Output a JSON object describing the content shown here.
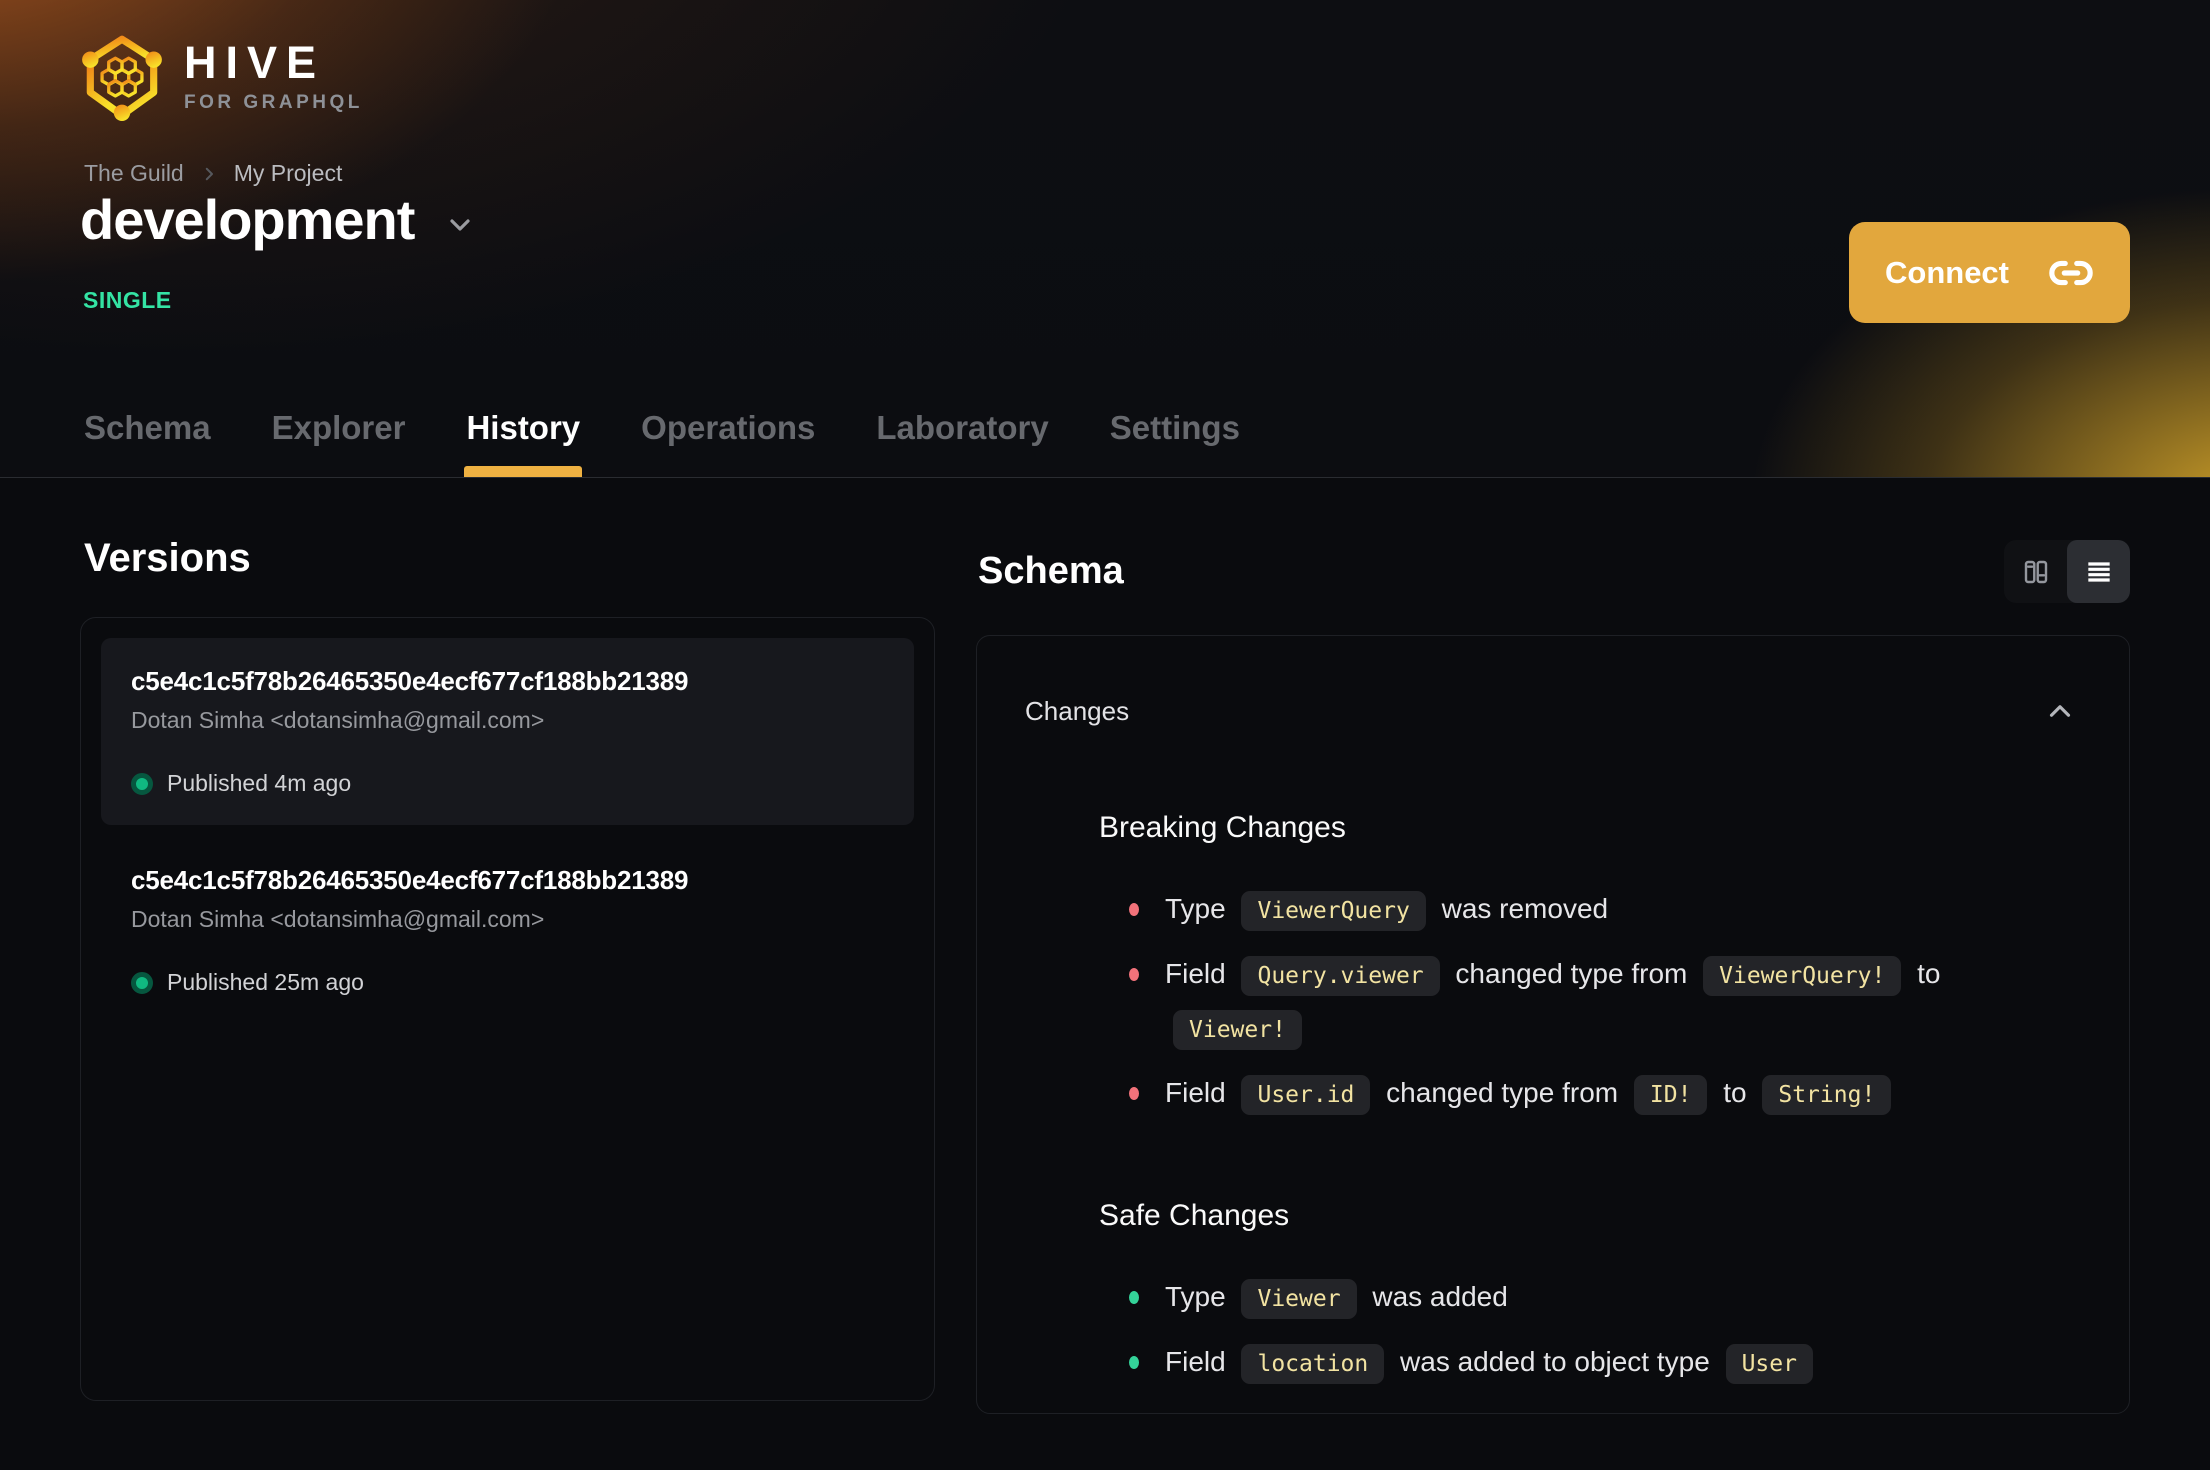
{
  "brand": {
    "name": "HIVE",
    "tagline": "FOR GRAPHQL"
  },
  "breadcrumb": {
    "org": "The Guild",
    "project": "My Project"
  },
  "target": {
    "name": "development",
    "badge": "SINGLE"
  },
  "connect": {
    "label": "Connect"
  },
  "tabs": [
    {
      "label": "Schema",
      "active": false
    },
    {
      "label": "Explorer",
      "active": false
    },
    {
      "label": "History",
      "active": true
    },
    {
      "label": "Operations",
      "active": false
    },
    {
      "label": "Laboratory",
      "active": false
    },
    {
      "label": "Settings",
      "active": false
    }
  ],
  "versions": {
    "title": "Versions",
    "items": [
      {
        "hash": "c5e4c1c5f78b26465350e4ecf677cf188bb21389",
        "author": "Dotan Simha <dotansimha@gmail.com>",
        "status": "Published 4m ago",
        "selected": true
      },
      {
        "hash": "c5e4c1c5f78b26465350e4ecf677cf188bb21389",
        "author": "Dotan Simha <dotansimha@gmail.com>",
        "status": "Published 25m ago",
        "selected": false
      }
    ]
  },
  "schema": {
    "title": "Schema",
    "panel": {
      "header": "Changes",
      "sections": [
        {
          "title": "Breaking Changes",
          "severity": "breaking",
          "items": [
            [
              {
                "t": "text",
                "v": "Type "
              },
              {
                "t": "code",
                "v": "ViewerQuery"
              },
              {
                "t": "text",
                "v": " was removed"
              }
            ],
            [
              {
                "t": "text",
                "v": "Field "
              },
              {
                "t": "code",
                "v": "Query.viewer"
              },
              {
                "t": "text",
                "v": " changed type from "
              },
              {
                "t": "code",
                "v": "ViewerQuery!"
              },
              {
                "t": "text",
                "v": " to "
              },
              {
                "t": "code",
                "v": "Viewer!"
              }
            ],
            [
              {
                "t": "text",
                "v": "Field "
              },
              {
                "t": "code",
                "v": "User.id"
              },
              {
                "t": "text",
                "v": " changed type from "
              },
              {
                "t": "code",
                "v": "ID!"
              },
              {
                "t": "text",
                "v": " to "
              },
              {
                "t": "code",
                "v": "String!"
              }
            ]
          ]
        },
        {
          "title": "Safe Changes",
          "severity": "safe",
          "items": [
            [
              {
                "t": "text",
                "v": "Type "
              },
              {
                "t": "code",
                "v": "Viewer"
              },
              {
                "t": "text",
                "v": " was added"
              }
            ],
            [
              {
                "t": "text",
                "v": "Field "
              },
              {
                "t": "code",
                "v": "location"
              },
              {
                "t": "text",
                "v": " was added to object type "
              },
              {
                "t": "code",
                "v": "User"
              }
            ]
          ]
        }
      ]
    }
  },
  "colors": {
    "accent": "#e2a73d",
    "tab_underline": "#efb142",
    "badge_single": "#34e3a4",
    "published_dot": "#10b981",
    "breaking_bullet": "#f2727a",
    "safe_bullet": "#34d399",
    "code_text": "#f2e3a2",
    "code_bg": "#232428"
  }
}
